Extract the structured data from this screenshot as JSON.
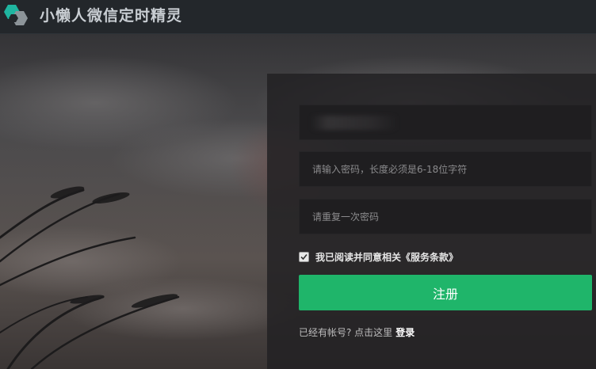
{
  "header": {
    "app_title": "小懒人微信定时精灵",
    "logo_icon": "hexagon-logo-icon"
  },
  "register_form": {
    "phone_field": {
      "value": "",
      "placeholder": ""
    },
    "password_field": {
      "value": "",
      "placeholder": "请输入密码，长度必须是6-18位字符"
    },
    "confirm_field": {
      "value": "",
      "placeholder": "请重复一次密码"
    },
    "agree": {
      "checked": true,
      "label": "我已阅读并同意相关《服务条款》"
    },
    "submit_label": "注册",
    "login_prompt": "已经有帐号? 点击这里",
    "login_link": "登录"
  },
  "colors": {
    "header_bg": "#23272b",
    "panel_bg": "#212022",
    "accent_green": "#1fb56a"
  }
}
